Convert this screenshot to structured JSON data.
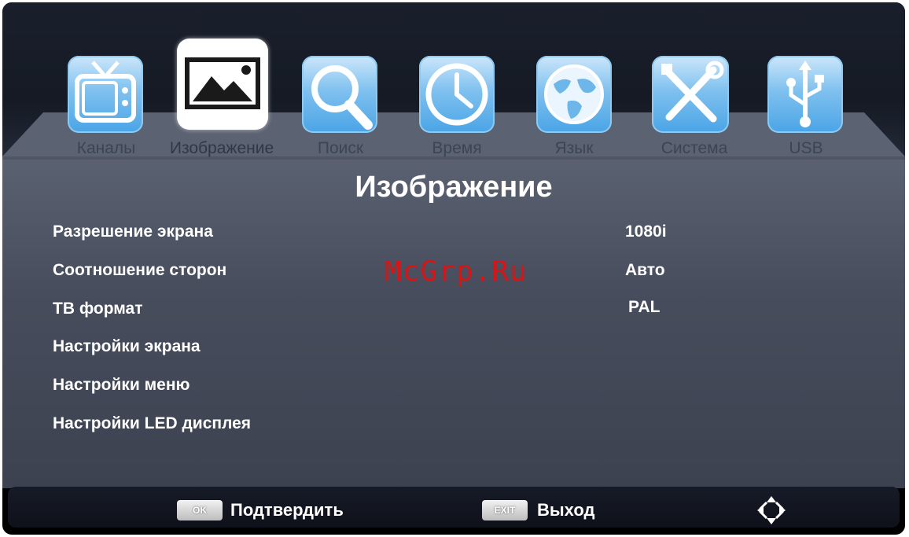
{
  "tabs": [
    {
      "label": "Каналы",
      "icon": "tv-icon"
    },
    {
      "label": "Изображение",
      "icon": "picture-icon"
    },
    {
      "label": "Поиск",
      "icon": "search-icon"
    },
    {
      "label": "Время",
      "icon": "clock-icon"
    },
    {
      "label": "Язык",
      "icon": "globe-icon"
    },
    {
      "label": "Система",
      "icon": "tools-icon"
    },
    {
      "label": "USB",
      "icon": "usb-icon"
    }
  ],
  "active_tab": "Изображение",
  "page_title": "Изображение",
  "settings": [
    {
      "label": "Разрешение экрана",
      "value": "1080i"
    },
    {
      "label": "Соотношение сторон",
      "value": "Авто"
    },
    {
      "label": "ТВ формат",
      "value": "PAL"
    },
    {
      "label": "Настройки экрана",
      "value": ""
    },
    {
      "label": "Настройки меню",
      "value": ""
    },
    {
      "label": "Настройки LED дисплея",
      "value": ""
    }
  ],
  "watermark": "McGrp.Ru",
  "footer": {
    "ok_key": "OK",
    "ok_label": "Подтвердить",
    "exit_key": "EXIT",
    "exit_label": "Выход"
  },
  "colors": {
    "tile_blue": "#4aa4e6",
    "panel": "#474d5c",
    "watermark": "#d81414"
  }
}
